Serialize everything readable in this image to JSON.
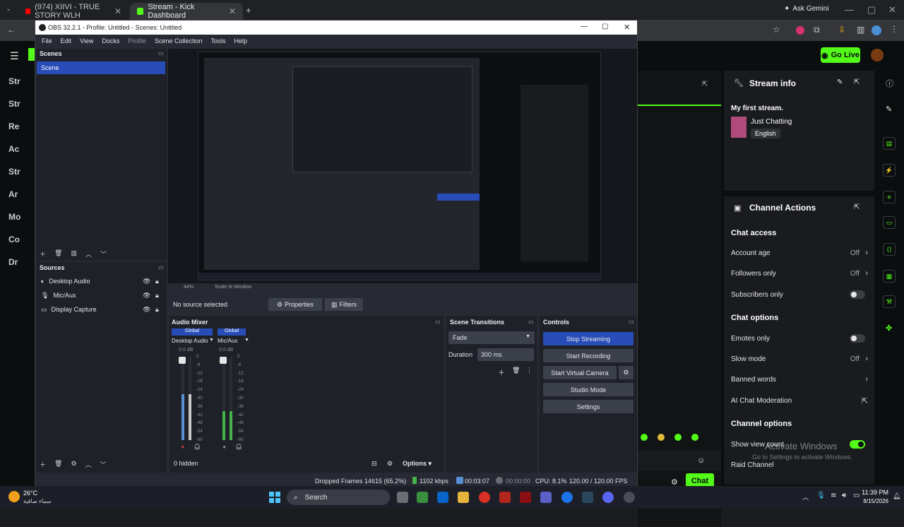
{
  "browser": {
    "tabs": [
      {
        "label": "(974) XIIVI - TRUE STORY WLH"
      },
      {
        "label": "Stream - Kick Dashboard"
      }
    ],
    "ask_gemini": "Ask Gemini"
  },
  "kick": {
    "sidebar_items": [
      "Str",
      "Str",
      "Re",
      "Ac",
      "Str",
      "Ar",
      "Mo",
      "Co",
      "Dr"
    ],
    "go_live": "Go Live",
    "stream_info": {
      "title": "Stream info",
      "stream_title": "My first stream.",
      "category": "Just Chatting",
      "language": "English"
    },
    "channel_actions": {
      "title": "Channel Actions",
      "chat_access": "Chat access",
      "account_age": {
        "label": "Account age",
        "value": "Off"
      },
      "followers_only": {
        "label": "Followers only",
        "value": "Off"
      },
      "subscribers_only": {
        "label": "Subscribers only",
        "on": false
      },
      "chat_options": "Chat options",
      "emotes_only": {
        "label": "Emotes only",
        "on": false
      },
      "slow_mode": {
        "label": "Slow mode",
        "value": "Off"
      },
      "banned_words": "Banned words",
      "ai_moderation": "AI Chat Moderation",
      "channel_options": "Channel options",
      "show_view_count": {
        "label": "Show view count",
        "on": true
      },
      "raid_channel": "Raid Channel"
    },
    "chat_button": "Chat",
    "activate_windows": "Activate Windows",
    "activate_windows_sub": "Go to Settings to activate Windows."
  },
  "obs": {
    "title": "OBS 32.2.1 - Profile: Untitled - Scenes: Untitled",
    "menu": [
      "File",
      "Edit",
      "View",
      "Docks",
      "Profile",
      "Scene Collection",
      "Tools",
      "Help"
    ],
    "scenes_title": "Scenes",
    "scene_selected": "Scene",
    "sources_title": "Sources",
    "sources": [
      "Desktop Audio",
      "Mic/Aux",
      "Display Capture"
    ],
    "no_source": "No source selected",
    "properties": "Properties",
    "filters": "Filters",
    "audio_mixer": "Audio Mixer",
    "channels": [
      {
        "tag": "Global",
        "name": "Desktop Audio",
        "db": "0.0 dB",
        "level": 0.55
      },
      {
        "tag": "Global",
        "name": "Mic/Aux",
        "db": "0.0 dB",
        "level": 0.35
      }
    ],
    "scale_ticks": [
      "0",
      "-6",
      "-12",
      "-18",
      "-24",
      "-30",
      "-36",
      "-42",
      "-48",
      "-54",
      "-60"
    ],
    "hidden_count": "0 hidden",
    "options": "Options",
    "transitions_title": "Scene Transitions",
    "transition": "Fade",
    "duration_label": "Duration",
    "duration_value": "300 ms",
    "controls_title": "Controls",
    "controls": [
      "Stop Streaming",
      "Start Recording",
      "Start Virtual Camera",
      "Studio Mode",
      "Settings"
    ],
    "status": {
      "dropped": "Dropped Frames 14615 (65.2%)",
      "kbps": "1102 kbps",
      "stream_time": "00:03:07",
      "rec_time": "00:00:00",
      "cpu": "CPU: 8.1%",
      "fps": "120.00 / 120.00 FPS"
    },
    "preview_scale": "44%",
    "preview_mode": "Scale to Window"
  },
  "taskbar": {
    "weather_temp": "26°C",
    "weather_desc": "سماء صافية",
    "search": "Search",
    "time": "11:39 PM",
    "date": "8/15/2026"
  }
}
